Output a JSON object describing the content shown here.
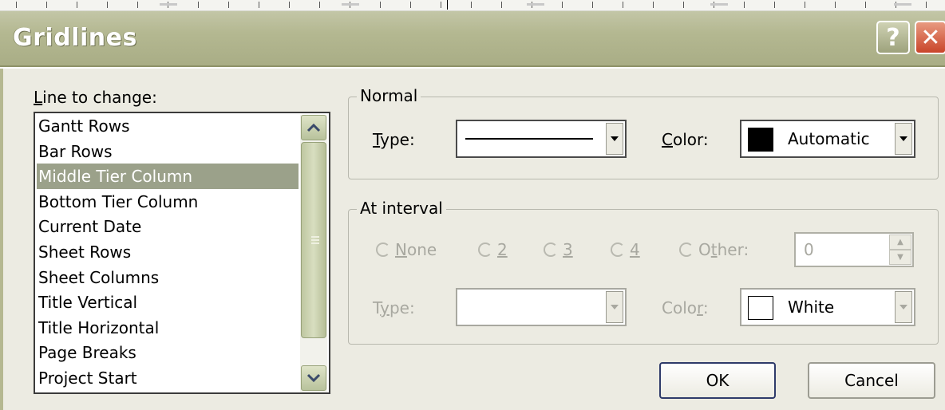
{
  "dialog": {
    "title": "Gridlines",
    "help_label": "?",
    "close_label": "✕"
  },
  "line_to_change": {
    "label": "Line to change:",
    "items": [
      {
        "label": "Gantt Rows"
      },
      {
        "label": "Bar Rows"
      },
      {
        "label": "Middle Tier Column",
        "selected": true
      },
      {
        "label": "Bottom Tier Column"
      },
      {
        "label": "Current Date"
      },
      {
        "label": "Sheet Rows"
      },
      {
        "label": "Sheet Columns"
      },
      {
        "label": "Title Vertical"
      },
      {
        "label": "Title Horizontal"
      },
      {
        "label": "Page Breaks"
      },
      {
        "label": "Project Start"
      }
    ]
  },
  "normal": {
    "legend": "Normal",
    "type_label": "Type:",
    "color_label": "Color:",
    "color_value": "Automatic",
    "color_swatch": "#000000"
  },
  "at_interval": {
    "legend": "At interval",
    "options": [
      "None",
      "2",
      "3",
      "4",
      "Other:"
    ],
    "other_value": "0",
    "type_label": "Type:",
    "color_label": "Color:",
    "color_value": "White",
    "color_swatch": "#ffffff",
    "enabled": false
  },
  "buttons": {
    "ok": "OK",
    "cancel": "Cancel"
  },
  "colors": {
    "titlebar": "#b4b891",
    "selection": "#9ba18a",
    "dialog_bg": "#ecebe2",
    "disabled_text": "#a8a8a0"
  }
}
